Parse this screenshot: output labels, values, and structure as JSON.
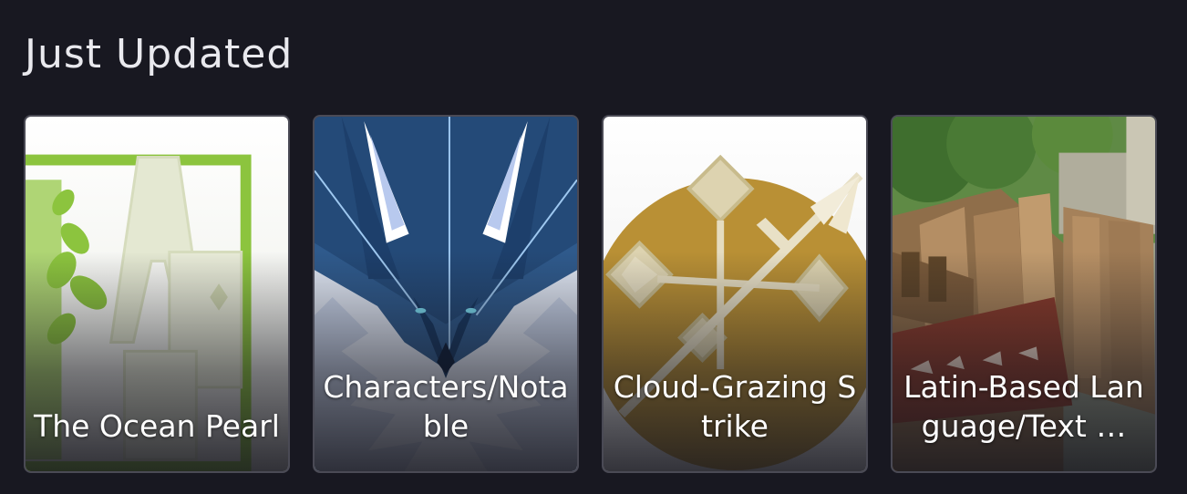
{
  "section": {
    "title": "Just Updated"
  },
  "cards": [
    {
      "title": "The Ocean Pearl",
      "image": "ae-leaf-emblem"
    },
    {
      "title": "Characters/Notable",
      "image": "blue-wolf-portrait"
    },
    {
      "title": "Cloud-Grazing Strike",
      "image": "golden-spear-emblem"
    },
    {
      "title": "Latin-Based Language/Text …",
      "image": "wooden-crates-scene"
    }
  ],
  "colors": {
    "background": "#181821",
    "card_border": "#4a4a55",
    "title_text": "#e9e9ee"
  }
}
